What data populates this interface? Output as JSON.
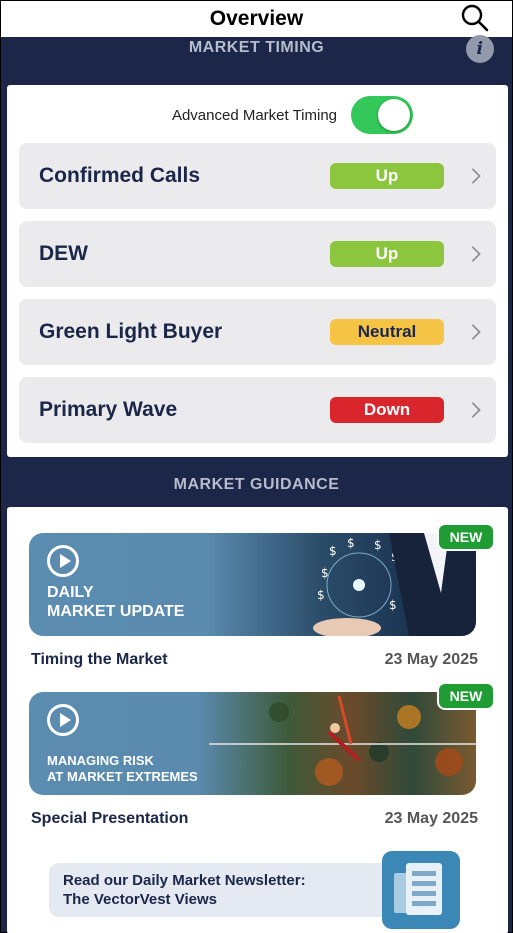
{
  "header": {
    "title": "Overview"
  },
  "market_timing": {
    "section_title": "MARKET TIMING",
    "toggle_label": "Advanced Market Timing",
    "toggle_on": true,
    "rows": [
      {
        "name": "Confirmed Calls",
        "status": "Up",
        "color": "#8cc63f"
      },
      {
        "name": "DEW",
        "status": "Up",
        "color": "#8cc63f"
      },
      {
        "name": "Green Light Buyer",
        "status": "Neutral",
        "color": "#f5c445"
      },
      {
        "name": "Primary Wave",
        "status": "Down",
        "color": "#d8262c"
      }
    ]
  },
  "market_guidance": {
    "section_title": "MARKET GUIDANCE",
    "cards": [
      {
        "badge": "NEW",
        "thumb_line1": "DAILY",
        "thumb_line2": "MARKET UPDATE",
        "title": "Timing the Market",
        "date": "23 May 2025"
      },
      {
        "badge": "NEW",
        "thumb_line1": "MANAGING RISK",
        "thumb_line2": "AT MARKET EXTREMES",
        "title": "Special Presentation",
        "date": "23 May 2025"
      }
    ],
    "newsletter": {
      "line1": "Read our Daily Market Newsletter:",
      "line2": "The VectorVest Views"
    }
  }
}
